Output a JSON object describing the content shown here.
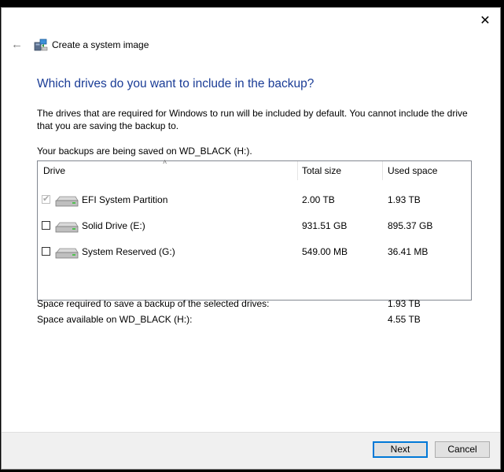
{
  "window": {
    "close_glyph": "✕"
  },
  "header": {
    "back_icon": "back-arrow-icon",
    "title": "Create a system image"
  },
  "main": {
    "heading": "Which drives do you want to include in the backup?",
    "description": "The drives that are required for Windows to run will be included by default. You cannot include the drive that you are saving the backup to.",
    "saved_on": "Your backups are being saved on WD_BLACK (H:).",
    "table": {
      "columns": [
        "Drive",
        "Total size",
        "Used space"
      ],
      "sort_column": "Drive",
      "rows": [
        {
          "checked": true,
          "disabled": true,
          "name": "EFI System Partition",
          "total": "2.00 TB",
          "used": "1.93 TB"
        },
        {
          "checked": false,
          "disabled": false,
          "name": "Solid Drive (E:)",
          "total": "931.51 GB",
          "used": "895.37 GB"
        },
        {
          "checked": false,
          "disabled": false,
          "name": "System Reserved (G:)",
          "total": "549.00 MB",
          "used": "36.41 MB"
        }
      ]
    },
    "summary": {
      "required_label": "Space required to save a backup of the selected drives:",
      "required_value": "1.93 TB",
      "available_label": "Space available on WD_BLACK (H:):",
      "available_value": "4.55 TB"
    }
  },
  "footer": {
    "next_label": "Next",
    "cancel_label": "Cancel"
  },
  "colors": {
    "heading": "#1a3c96",
    "accent": "#0078d7"
  }
}
